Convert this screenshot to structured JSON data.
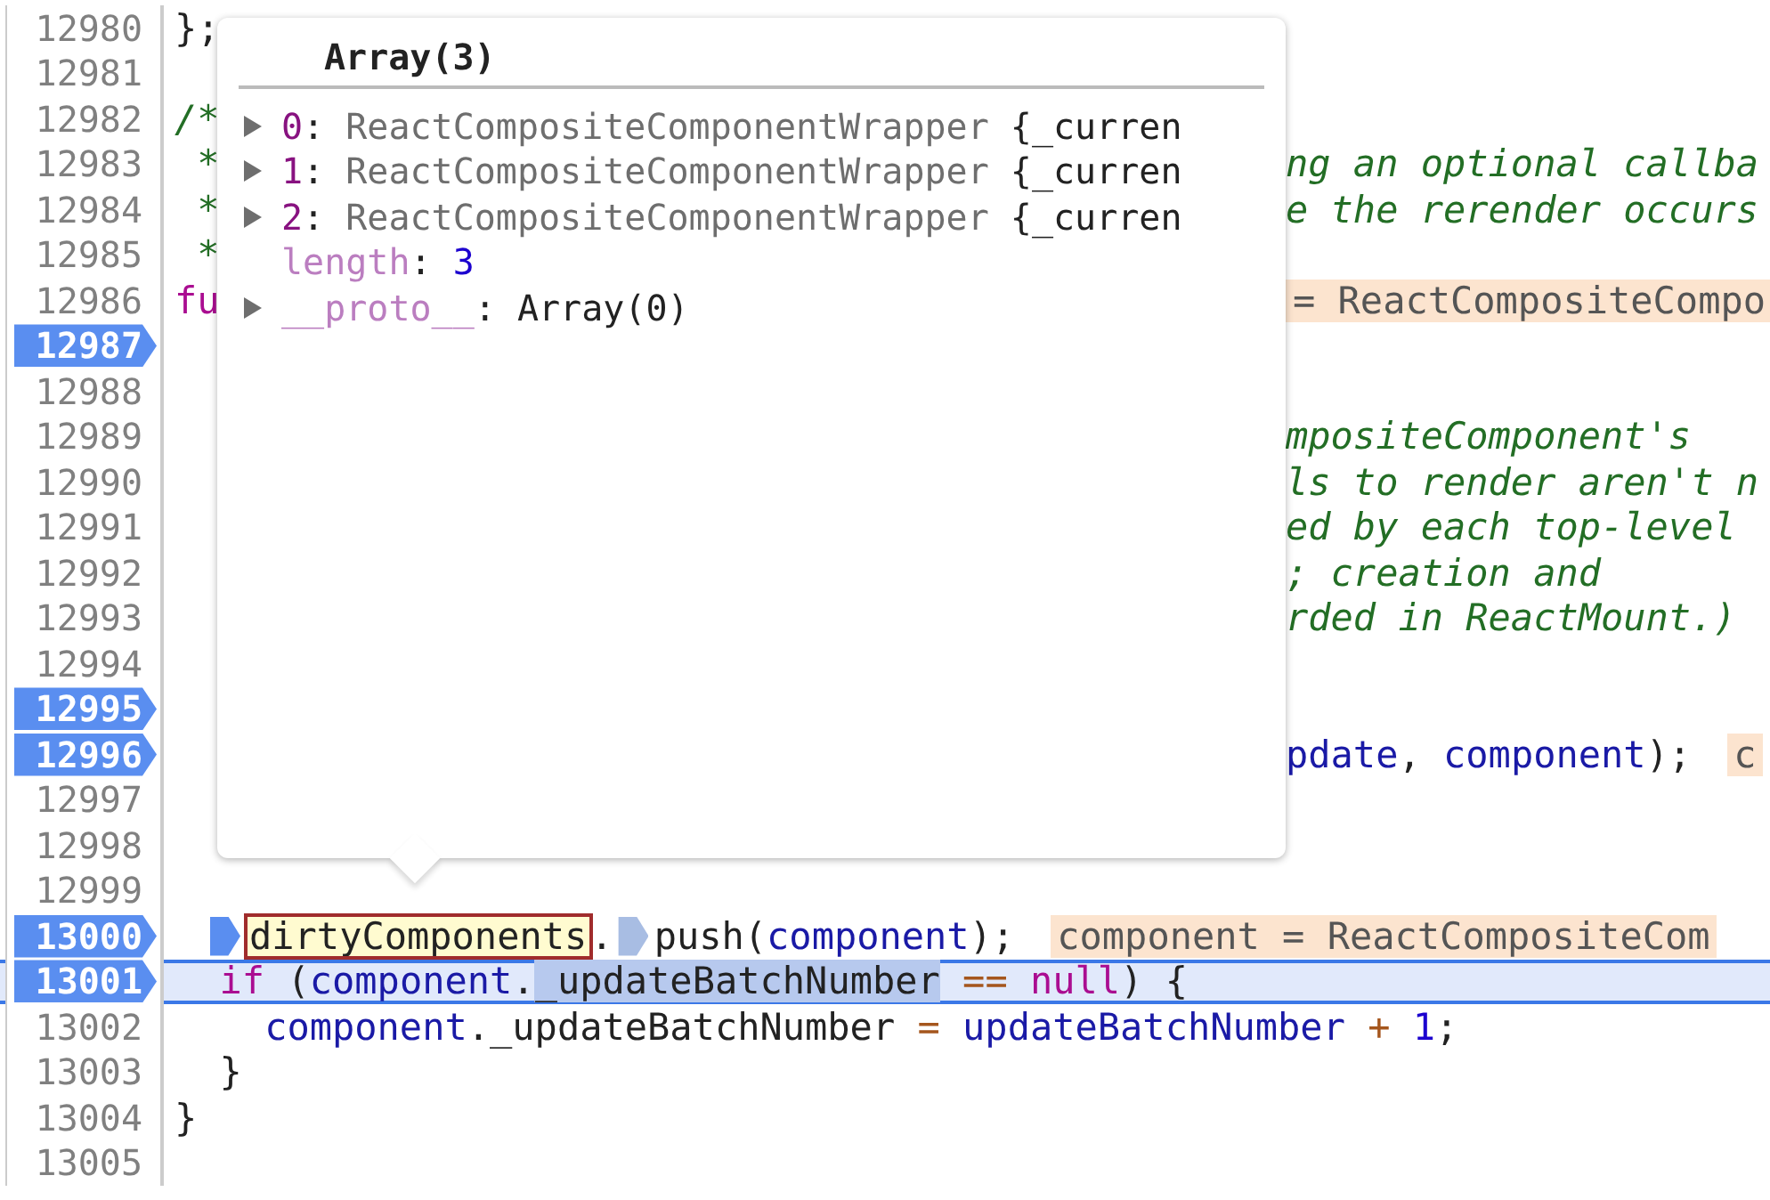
{
  "editor": {
    "lines": [
      {
        "number": "12980",
        "breakpoint": false,
        "current": false,
        "left": [
          {
            "text": "};",
            "kind": "plain"
          }
        ]
      },
      {
        "number": "12981",
        "breakpoint": false,
        "current": false
      },
      {
        "number": "12982",
        "breakpoint": false,
        "current": false,
        "left": [
          {
            "text": "/*",
            "kind": "comment"
          }
        ]
      },
      {
        "number": "12983",
        "breakpoint": false,
        "current": false,
        "left": [
          {
            "text": " *",
            "kind": "comment"
          }
        ],
        "right": [
          {
            "text": "ng an optional callba",
            "kind": "comment"
          }
        ]
      },
      {
        "number": "12984",
        "breakpoint": false,
        "current": false,
        "left": [
          {
            "text": " *",
            "kind": "comment"
          }
        ],
        "right": [
          {
            "text": "e the rerender occurs",
            "kind": "comment"
          }
        ]
      },
      {
        "number": "12985",
        "breakpoint": false,
        "current": false,
        "left": [
          {
            "text": " *",
            "kind": "comment"
          }
        ]
      },
      {
        "number": "12986",
        "breakpoint": false,
        "current": false,
        "left": [
          {
            "text": "fu",
            "kind": "keyword"
          }
        ],
        "right": [
          {
            "text": "= ReactCompositeCompo",
            "kind": "value"
          }
        ]
      },
      {
        "number": "12987",
        "breakpoint": true,
        "current": false
      },
      {
        "number": "12988",
        "breakpoint": false,
        "current": false
      },
      {
        "number": "12989",
        "breakpoint": false,
        "current": false,
        "right": [
          {
            "text": "mpositeComponent's",
            "kind": "comment"
          }
        ]
      },
      {
        "number": "12990",
        "breakpoint": false,
        "current": false,
        "right": [
          {
            "text": "ls to render aren't n",
            "kind": "comment"
          }
        ]
      },
      {
        "number": "12991",
        "breakpoint": false,
        "current": false,
        "right": [
          {
            "text": "ed by each top-level",
            "kind": "comment"
          }
        ]
      },
      {
        "number": "12992",
        "breakpoint": false,
        "current": false,
        "right": [
          {
            "text": "; creation and",
            "kind": "comment"
          }
        ]
      },
      {
        "number": "12993",
        "breakpoint": false,
        "current": false,
        "right": [
          {
            "text": "rded in ReactMount.)",
            "kind": "comment"
          }
        ]
      },
      {
        "number": "12994",
        "breakpoint": false,
        "current": false
      },
      {
        "number": "12995",
        "breakpoint": true,
        "current": false
      },
      {
        "number": "12996",
        "breakpoint": true,
        "current": false,
        "right": [
          {
            "text": "pdate",
            "kind": "ident"
          },
          {
            "text": ",",
            "kind": "plain"
          },
          {
            "text": " component",
            "kind": "ident"
          },
          {
            "text": ");",
            "kind": "plain"
          },
          {
            "text": "c",
            "kind": "value"
          }
        ]
      },
      {
        "number": "12997",
        "breakpoint": false,
        "current": false
      },
      {
        "number": "12998",
        "breakpoint": false,
        "current": false
      },
      {
        "number": "12999",
        "breakpoint": false,
        "current": false
      },
      {
        "number": "13000",
        "breakpoint": true,
        "current": false,
        "left": [
          {
            "kind": "marker",
            "current": true
          },
          {
            "text": "dirtyComponents",
            "kind": "found"
          },
          {
            "text": ".",
            "kind": "plain"
          },
          {
            "kind": "marker",
            "current": false
          },
          {
            "text": "push(",
            "kind": "plain"
          },
          {
            "text": "component",
            "kind": "ident"
          },
          {
            "text": ");",
            "kind": "plain"
          },
          {
            "text": "component = ReactCompositeCom",
            "kind": "value"
          }
        ]
      },
      {
        "number": "13001",
        "breakpoint": true,
        "current": true,
        "left": [
          {
            "text": "  if",
            "kind": "keyword"
          },
          {
            "text": " (",
            "kind": "plain"
          },
          {
            "text": "component",
            "kind": "ident"
          },
          {
            "text": ".",
            "kind": "plain"
          },
          {
            "text": "_updateBatchNumber",
            "kind": "sel"
          },
          {
            "text": " ==",
            "kind": "op"
          },
          {
            "text": " null",
            "kind": "keyword"
          },
          {
            "text": ") {",
            "kind": "plain"
          }
        ]
      },
      {
        "number": "13002",
        "breakpoint": false,
        "current": false,
        "left": [
          {
            "text": "    component",
            "kind": "ident"
          },
          {
            "text": "._updateBatchNumber",
            "kind": "plain"
          },
          {
            "text": " =",
            "kind": "op"
          },
          {
            "text": " updateBatchNumber",
            "kind": "ident"
          },
          {
            "text": " +",
            "kind": "op"
          },
          {
            "text": " 1",
            "kind": "num"
          },
          {
            "text": ";",
            "kind": "plain"
          }
        ]
      },
      {
        "number": "13003",
        "breakpoint": false,
        "current": false,
        "left": [
          {
            "text": "  }",
            "kind": "plain"
          }
        ]
      },
      {
        "number": "13004",
        "breakpoint": false,
        "current": false,
        "left": [
          {
            "text": "}",
            "kind": "plain"
          }
        ]
      },
      {
        "number": "13005",
        "breakpoint": false,
        "current": false
      }
    ]
  },
  "popover": {
    "title": "Array(3)",
    "entries": [
      {
        "key": "0",
        "colon": ":",
        "value": "ReactCompositeComponentWrapper",
        "preview": "{_curren",
        "kind": "element",
        "expandable": true
      },
      {
        "key": "1",
        "colon": ":",
        "value": "ReactCompositeComponentWrapper",
        "preview": "{_curren",
        "kind": "element",
        "expandable": true
      },
      {
        "key": "2",
        "colon": ":",
        "value": "ReactCompositeComponentWrapper",
        "preview": "{_curren",
        "kind": "element",
        "expandable": true
      },
      {
        "key": "length",
        "colon": ":",
        "value": "3",
        "kind": "number",
        "expandable": false
      },
      {
        "key": "__proto__",
        "colon": ":",
        "value": "Array(0)",
        "kind": "proto",
        "expandable": true
      }
    ]
  }
}
